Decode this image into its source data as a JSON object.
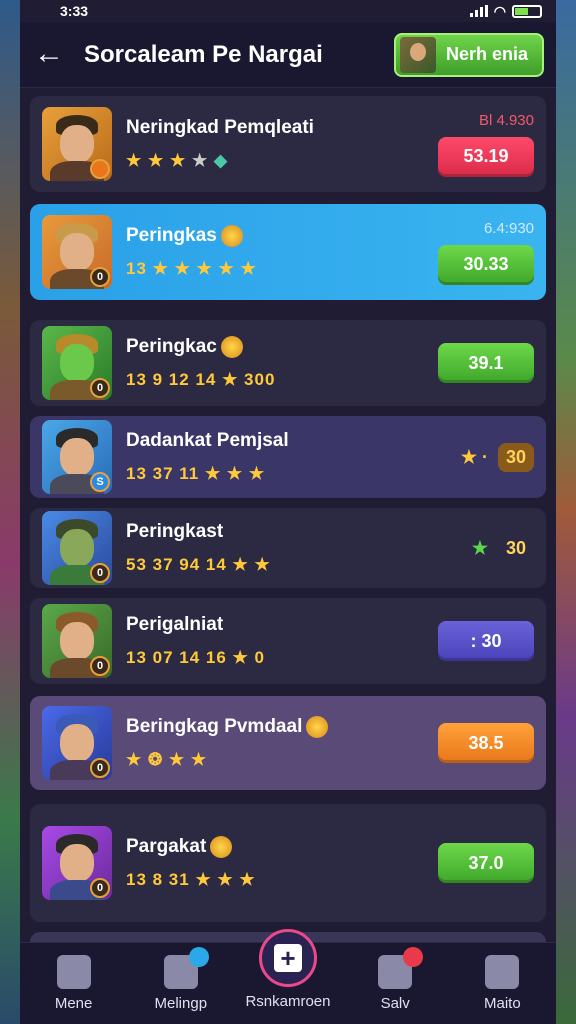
{
  "status": {
    "time": "3:33"
  },
  "header": {
    "title": "Sorcaleam Pe Nargai",
    "button_label": "Nerh enia"
  },
  "rows": [
    {
      "name": "Neringkad Pemqleati",
      "stats": [
        "★",
        "★",
        "★",
        "★"
      ],
      "score_top": "Bl 4.930",
      "pill": "53.19",
      "level": ""
    },
    {
      "name": "Peringkas",
      "stats_text": "13 ★ ★ ★ ★ ★",
      "score_top": "6.4:930",
      "pill": "30.33",
      "level": "0"
    },
    {
      "name": "Peringkac",
      "stats_text": "13 9 12 14 ★ 300",
      "pill": "39.1",
      "level": "0"
    },
    {
      "name": "Dadankat Pemjsal",
      "stats_text": "13 37 11 ★ ★ ★",
      "tag": "30",
      "level": "S"
    },
    {
      "name": "Peringkast",
      "stats_text": "53 37 94 14 ★ ★",
      "tag": "30",
      "level": "0"
    },
    {
      "name": "Perigalniat",
      "stats_text": "13 07 14 16 ★ 0",
      "pill": ": 30",
      "level": "0"
    },
    {
      "name": "Beringkag Pvmdaal",
      "stats_text": "★ ❂ ★ ★",
      "pill": "38.5",
      "level": "0"
    },
    {
      "name": "Pargakat",
      "stats_text": "13 8 31 ★ ★ ★",
      "pill": "37.0",
      "level": "0"
    }
  ],
  "nav": {
    "home": "Mene",
    "matching": "Melingp",
    "center": "Rsnkamroen",
    "salv": "Salv",
    "maito": "Maito"
  },
  "colors": {
    "accent_green": "#4ab82e",
    "highlight_blue": "#2aa0e8",
    "pill_red": "#e23352",
    "pill_orange": "#f08a28"
  }
}
